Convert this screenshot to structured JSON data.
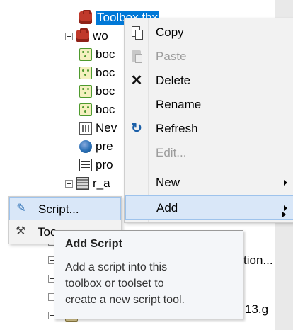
{
  "tree": {
    "items": [
      {
        "label": "Toolbox.tbx"
      },
      {
        "label": "wo"
      },
      {
        "label": "boc"
      },
      {
        "label": "boc"
      },
      {
        "label": "boc"
      },
      {
        "label": "boc"
      },
      {
        "label": "Nev"
      },
      {
        "label": "pre"
      },
      {
        "label": "pro"
      },
      {
        "label": "r_a"
      },
      {
        "label": "13.g"
      }
    ]
  },
  "context_menu": {
    "items": [
      {
        "label": "Copy",
        "icon": "copy-icon",
        "enabled": true
      },
      {
        "label": "Paste",
        "icon": "paste-icon",
        "enabled": false
      },
      {
        "label": "Delete",
        "icon": "delete-icon",
        "enabled": true
      },
      {
        "label": "Rename",
        "icon": "",
        "enabled": true
      },
      {
        "label": "Refresh",
        "icon": "refresh-icon",
        "enabled": true
      },
      {
        "label": "Edit...",
        "icon": "",
        "enabled": false
      },
      {
        "label": "New",
        "icon": "",
        "enabled": true,
        "submenu": true
      },
      {
        "label": "Add",
        "icon": "",
        "enabled": true,
        "submenu": true,
        "highlighted": true
      },
      {
        "label": "",
        "icon": "",
        "enabled": true,
        "submenu": true
      },
      {
        "label": "tion...",
        "icon": "",
        "enabled": true
      }
    ]
  },
  "add_submenu": {
    "items": [
      {
        "label": "Script...",
        "icon": "script-icon",
        "highlighted": true
      },
      {
        "label": "Too",
        "icon": "tool-icon",
        "highlighted": false
      }
    ]
  },
  "tooltip": {
    "title": "Add Script",
    "lines": [
      "Add a script into this",
      "toolbox or toolset to",
      "create a new script tool."
    ]
  },
  "colors": {
    "selection": "#0078d7",
    "menu_background": "#f2f2f2",
    "menu_highlight": "#d9e7f8",
    "tooltip_background": "#f4f6f9"
  }
}
